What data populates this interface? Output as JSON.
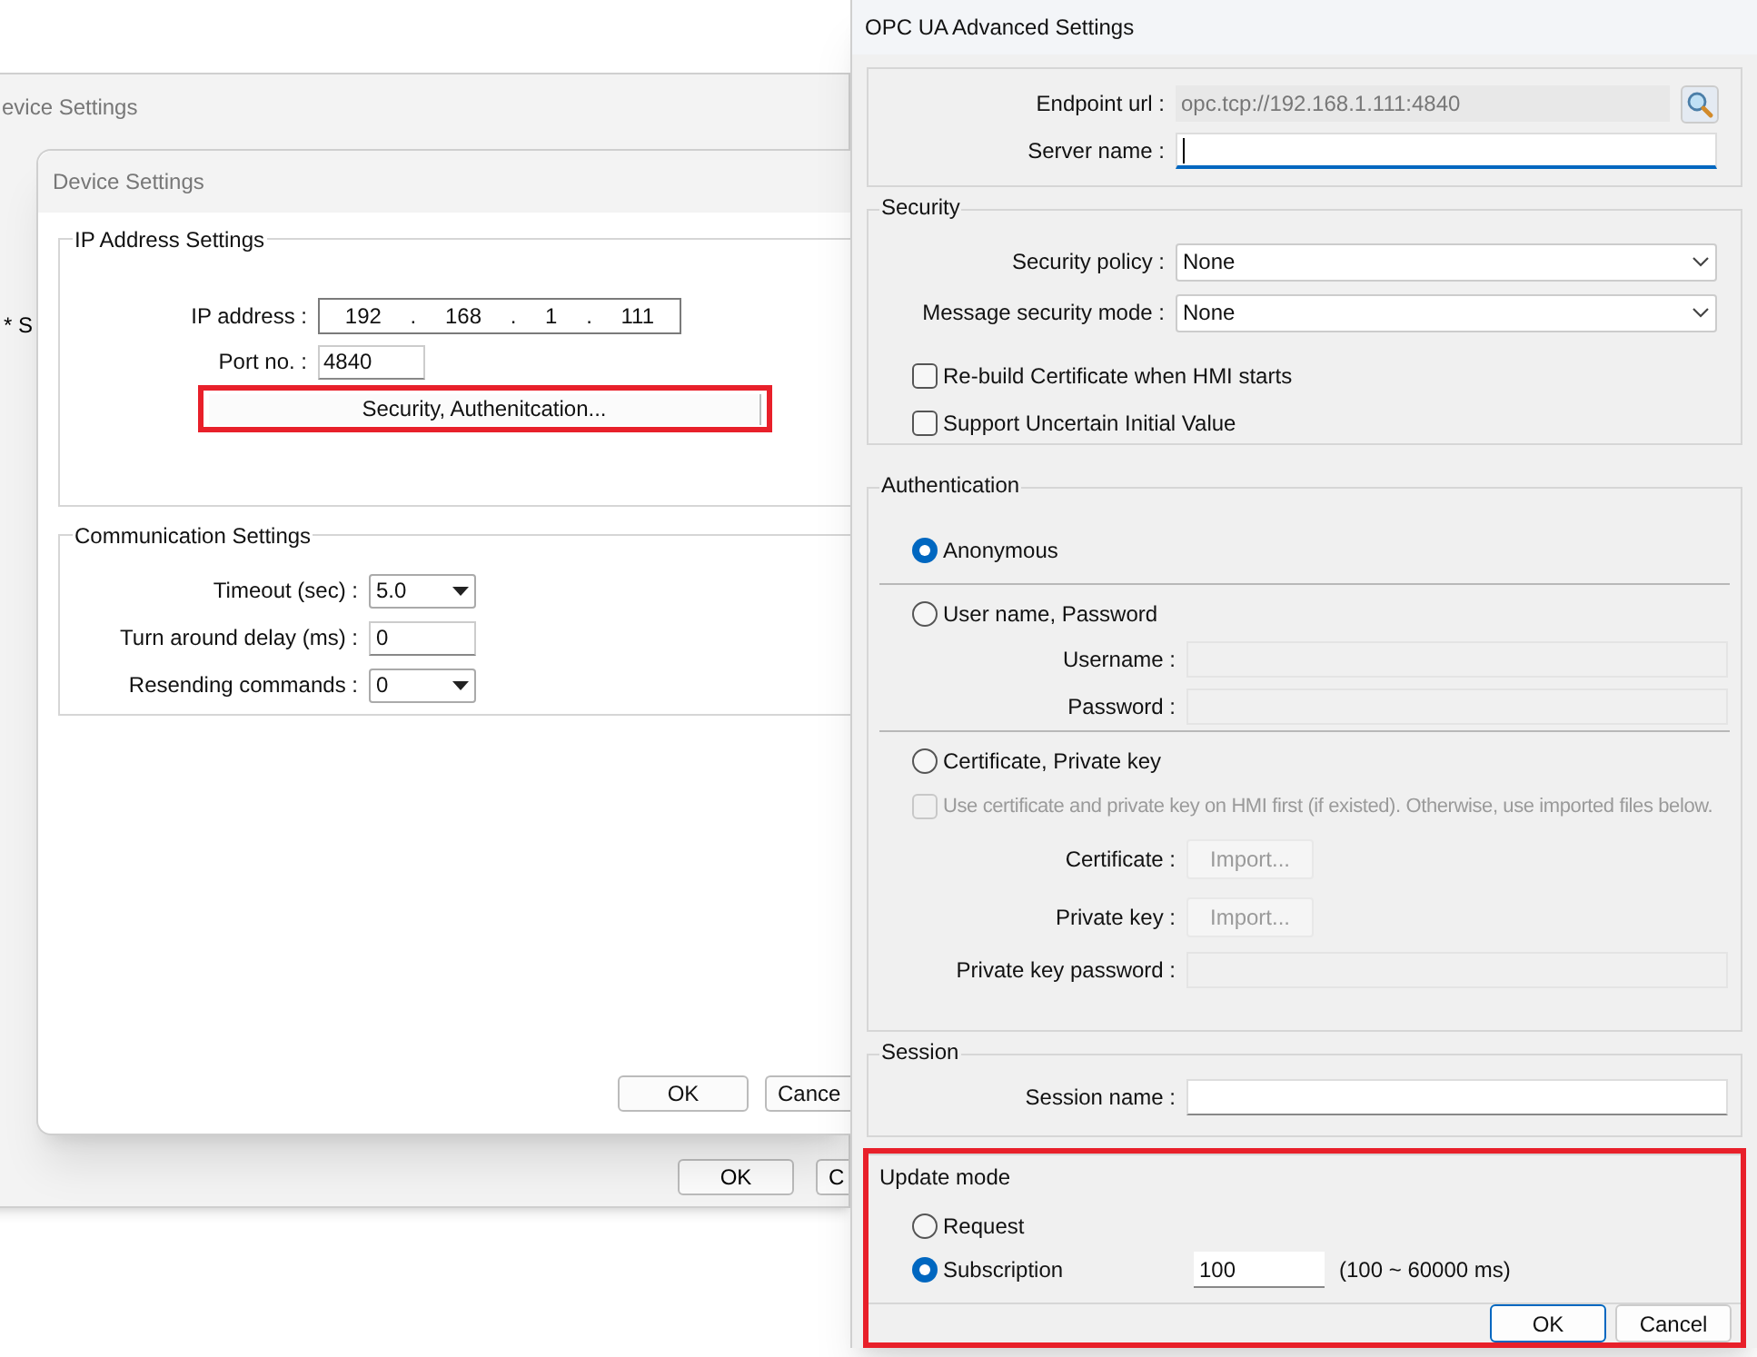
{
  "background_window": {
    "title": "evice Settings",
    "side_label": "* S",
    "buttons": [
      "OK",
      "C"
    ]
  },
  "device_window": {
    "title": "Device Settings",
    "ip_group": {
      "title": "IP Address Settings",
      "ip_label": "IP address :",
      "ip_octets": [
        "192",
        "168",
        "1",
        "111"
      ],
      "separator": ".",
      "port_label": "Port no. :",
      "port": "4840",
      "security_button": {
        "label": "Security, Authenitcation...",
        "highlighted": true
      }
    },
    "comm_group": {
      "title": "Communication Settings",
      "rows": [
        {
          "kind": "select",
          "label": "Timeout (sec) :",
          "value": "5.0"
        },
        {
          "kind": "input",
          "label": "Turn around delay (ms) :",
          "value": "0"
        },
        {
          "kind": "select",
          "label": "Resending commands :",
          "value": "0"
        }
      ]
    },
    "buttons": [
      "OK",
      "Cance"
    ]
  },
  "opc_window": {
    "title": "OPC UA Advanced Settings",
    "endpoint": {
      "label": "Endpoint url :",
      "value": "opc.tcp://192.168.1.111:4840",
      "disabled": true
    },
    "server_name": {
      "label": "Server name :",
      "focused": true
    },
    "security": {
      "title": "Security",
      "selects": [
        {
          "label": "Security policy :",
          "value": "None"
        },
        {
          "label": "Message security mode :",
          "value": "None"
        }
      ],
      "checkboxes": [
        {
          "label": "Re-build Certificate when HMI starts",
          "checked": false,
          "disabled": false
        },
        {
          "label": "Support Uncertain Initial Value",
          "checked": false,
          "disabled": false
        }
      ]
    },
    "authentication": {
      "title": "Authentication",
      "options": [
        {
          "label": "Anonymous",
          "selected": true
        },
        {
          "label": "User name, Password",
          "selected": false,
          "fields": [
            {
              "kind": "input",
              "label": "Username :",
              "disabled": true
            },
            {
              "kind": "input",
              "label": "Password :",
              "disabled": true
            }
          ]
        },
        {
          "label": "Certificate, Private key",
          "selected": false,
          "checkbox": {
            "label": "Use certificate and private key on HMI first (if existed). Otherwise, use imported files below.",
            "checked": false,
            "disabled": true
          },
          "fields": [
            {
              "kind": "import",
              "label": "Certificate :",
              "button": "Import...",
              "disabled": true
            },
            {
              "kind": "import",
              "label": "Private key :",
              "button": "Import...",
              "disabled": true
            },
            {
              "kind": "input",
              "label": "Private key password :",
              "disabled": true
            }
          ]
        }
      ]
    },
    "session": {
      "title": "Session",
      "label": "Session name :"
    },
    "update_mode": {
      "title": "Update mode",
      "highlighted": true,
      "options": [
        {
          "label": "Request",
          "selected": false
        },
        {
          "label": "Subscription",
          "selected": true,
          "value": "100",
          "range": "(100 ~ 60000 ms)"
        }
      ]
    },
    "buttons": [
      {
        "label": "OK",
        "default": true
      },
      {
        "label": "Cancel",
        "default": false
      }
    ]
  }
}
